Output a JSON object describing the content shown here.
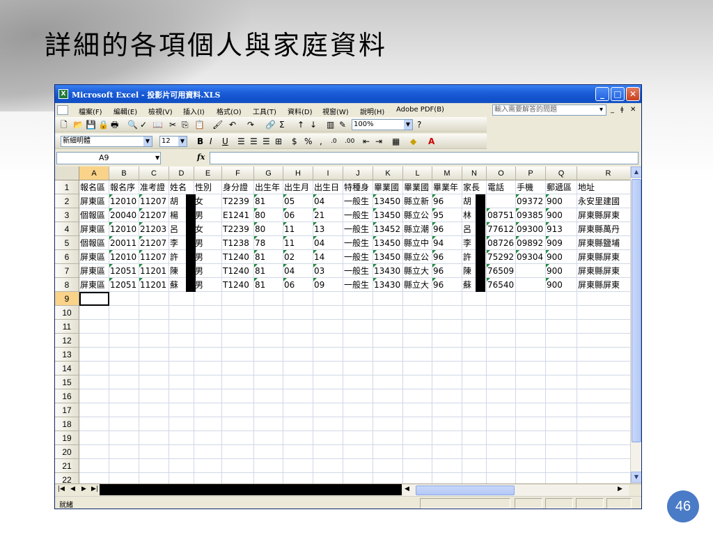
{
  "slide": {
    "title": "詳細的各項個人與家庭資料",
    "page_number": "46"
  },
  "window": {
    "title": "Microsoft Excel - 投影片可用資料.XLS",
    "app_icon": "excel-icon",
    "caption_buttons": {
      "minimize": "_",
      "maximize": "□",
      "close": "✕"
    }
  },
  "menubar": {
    "items": [
      "檔案(F)",
      "編輯(E)",
      "檢視(V)",
      "插入(I)",
      "格式(O)",
      "工具(T)",
      "資料(D)",
      "視窗(W)",
      "說明(H)",
      "Adobe PDF(B)"
    ],
    "help_placeholder": "輸入需要解答的問題",
    "controls": [
      "▾",
      "_",
      "ǂ",
      "✕"
    ]
  },
  "toolbar_standard": {
    "icons": [
      "new-icon",
      "open-icon",
      "save-icon",
      "permission-icon",
      "print-icon",
      "print-preview-icon",
      "spelling-icon",
      "research-icon",
      "cut-icon",
      "copy-icon",
      "paste-icon",
      "format-painter-icon",
      "undo-icon",
      "redo-icon",
      "hyperlink-icon",
      "autosum-icon",
      "sort-ascending-icon",
      "sort-descending-icon",
      "chart-wizard-icon",
      "drawing-icon",
      "help-icon"
    ],
    "zoom": "100%"
  },
  "toolbar_formatting": {
    "font": "新細明體",
    "font_size": "12",
    "buttons": [
      "B",
      "I",
      "U",
      "$",
      "%",
      ","
    ],
    "icons": [
      "align-left-icon",
      "center-icon",
      "align-right-icon",
      "merge-center-icon",
      "increase-decimal-icon",
      "decrease-decimal-icon",
      "decrease-indent-icon",
      "increase-indent-icon",
      "borders-icon",
      "fill-color-icon",
      "font-color-icon"
    ],
    "font_color_letter": "A"
  },
  "formula_bar": {
    "name_box": "A9",
    "fx": "fx",
    "content": ""
  },
  "sheet": {
    "columns": [
      "A",
      "B",
      "C",
      "D",
      "E",
      "F",
      "G",
      "H",
      "I",
      "J",
      "K",
      "L",
      "M",
      "N",
      "O",
      "P",
      "Q",
      "R"
    ],
    "selected_column": "A",
    "row_numbers": [
      "1",
      "2",
      "3",
      "4",
      "5",
      "6",
      "7",
      "8",
      "9",
      "10",
      "11",
      "12",
      "13",
      "14",
      "15",
      "16",
      "17",
      "18",
      "19",
      "20",
      "21",
      "22"
    ],
    "selected_row": "9",
    "active_cell": "A9",
    "rows": [
      [
        "報名區",
        "報名序",
        "准考證",
        "姓名",
        "性別",
        "身分證",
        "出生年",
        "出生月",
        "出生日",
        "特種身",
        "畢業國",
        "畢業國",
        "畢業年",
        "家長",
        "電話",
        "手機",
        "郵遞區",
        "地址"
      ],
      [
        "屏東區",
        "12010",
        "11207",
        "胡",
        "女",
        "T2239",
        "81",
        "05",
        "04",
        "一般生",
        "13450",
        "縣立新",
        "96",
        "胡",
        "",
        "09372",
        "900",
        "永安里建國"
      ],
      [
        "個報區",
        "20040",
        "21207",
        "楊",
        "男",
        "E1241",
        "80",
        "06",
        "21",
        "一般生",
        "13450",
        "縣立公",
        "95",
        "林",
        "08751",
        "09385",
        "900",
        "屏東縣屏東"
      ],
      [
        "屏東區",
        "12010",
        "21203",
        "呂",
        "女",
        "T2239",
        "80",
        "11",
        "13",
        "一般生",
        "13452",
        "縣立潮",
        "96",
        "呂",
        "77612",
        "09300",
        "913",
        "屏東縣萬丹"
      ],
      [
        "個報區",
        "20011",
        "21207",
        "李",
        "男",
        "T1238",
        "78",
        "11",
        "04",
        "一般生",
        "13450",
        "縣立中",
        "94",
        "李",
        "08726",
        "09892",
        "909",
        "屏東縣鹽埔"
      ],
      [
        "屏東區",
        "12010",
        "11207",
        "許",
        "男",
        "T1240",
        "81",
        "02",
        "14",
        "一般生",
        "13450",
        "縣立公",
        "96",
        "許",
        "75292",
        "09304",
        "900",
        "屏東縣屏東"
      ],
      [
        "屏東區",
        "12051",
        "11201",
        "陳",
        "男",
        "T1240",
        "81",
        "04",
        "03",
        "一般生",
        "13430",
        "縣立大",
        "96",
        "陳",
        "76509",
        "",
        "900",
        "屏東縣屏東"
      ],
      [
        "屏東區",
        "12051",
        "11201",
        "蘇",
        "男",
        "T1240",
        "81",
        "06",
        "09",
        "一般生",
        "13430",
        "縣立大",
        "96",
        "蘇",
        "76540",
        "",
        "900",
        "屏東縣屏東"
      ]
    ]
  },
  "sheet_nav": {
    "arrows": [
      "|◀",
      "◀",
      "▶",
      "▶|"
    ]
  },
  "status_bar": {
    "text": "就緒"
  },
  "colors": {
    "titlebar": "#1c5fd9",
    "selected_header": "#f9d38a",
    "error_triangle": "#1e8a3c",
    "page_badge": "#4a7bc6"
  }
}
